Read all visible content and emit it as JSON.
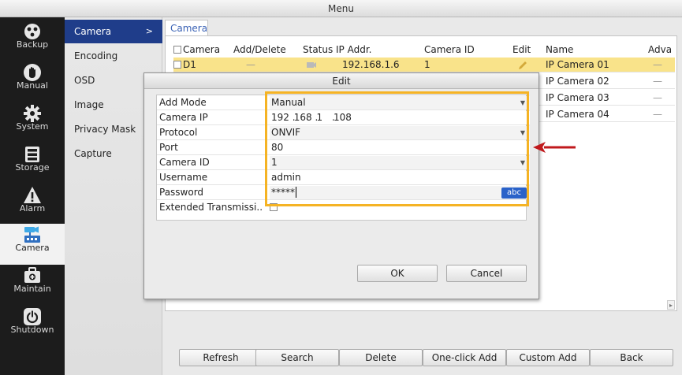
{
  "window": {
    "title": "Menu"
  },
  "nav": [
    {
      "label": "Backup",
      "icon": "backup-icon"
    },
    {
      "label": "Manual",
      "icon": "manual-hand-icon"
    },
    {
      "label": "System",
      "icon": "gear-icon"
    },
    {
      "label": "Storage",
      "icon": "storage-icon"
    },
    {
      "label": "Alarm",
      "icon": "alarm-warning-icon"
    },
    {
      "label": "Camera",
      "icon": "camera-icon",
      "active": true
    },
    {
      "label": "Maintain",
      "icon": "toolbox-icon"
    },
    {
      "label": "Shutdown",
      "icon": "power-icon"
    }
  ],
  "subnav": [
    {
      "label": "Camera",
      "active": true,
      "arrow": ">"
    },
    {
      "label": "Encoding"
    },
    {
      "label": "OSD"
    },
    {
      "label": "Image"
    },
    {
      "label": "Privacy Mask"
    },
    {
      "label": "Capture"
    }
  ],
  "tab": {
    "label": "Camera"
  },
  "table": {
    "columns": [
      "Camera",
      "Add/Delete",
      "Status",
      "IP Addr.",
      "Camera ID",
      "Edit",
      "Name",
      "Adva"
    ],
    "rows": [
      {
        "camera": "D1",
        "add_delete": "—",
        "ip": "192.168.1.6",
        "camera_id": "1",
        "name": "IP Camera 01",
        "adv": "—"
      },
      {
        "name": "IP Camera 02",
        "adv": "—"
      },
      {
        "name": "IP Camera 03",
        "adv": "—"
      },
      {
        "name": "IP Camera 04",
        "adv": "—"
      }
    ]
  },
  "buttons": {
    "refresh": "Refresh",
    "search": "Search",
    "delete": "Delete",
    "one_click_add": "One-click Add",
    "custom_add": "Custom Add",
    "back": "Back"
  },
  "dialog": {
    "title": "Edit",
    "fields": {
      "add_mode": {
        "label": "Add Mode",
        "value": "Manual"
      },
      "camera_ip": {
        "label": "Camera IP",
        "octets": [
          "192",
          "168",
          "1",
          "108"
        ]
      },
      "protocol": {
        "label": "Protocol",
        "value": "ONVIF"
      },
      "port": {
        "label": "Port",
        "value": "80"
      },
      "camera_id": {
        "label": "Camera ID",
        "value": "1"
      },
      "username": {
        "label": "Username",
        "value": "admin"
      },
      "password": {
        "label": "Password",
        "value": "*****",
        "ime": "abc"
      },
      "extended": {
        "label": "Extended Transmissi.."
      }
    },
    "ok": "OK",
    "cancel": "Cancel"
  },
  "colors": {
    "nav_bg": "#1c1c1c",
    "subnav_active": "#1f3d8a",
    "row_selected": "#f9e38a",
    "highlight_border": "#f5b324",
    "callout_arrow": "#c0191c",
    "ime_badge": "#2a62c9"
  }
}
